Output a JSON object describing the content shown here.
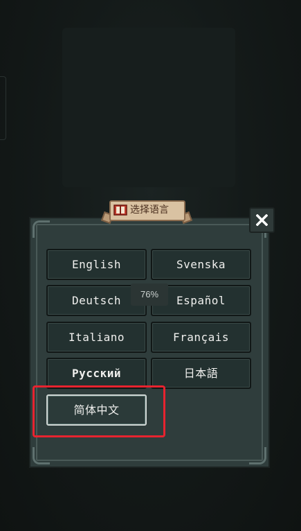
{
  "dialog": {
    "title": "选择语言",
    "close_icon": "close-icon",
    "title_icon": "book-icon"
  },
  "languages": [
    {
      "label": "English"
    },
    {
      "label": "Svenska"
    },
    {
      "label": "Deutsch"
    },
    {
      "label": "Español"
    },
    {
      "label": "Italiano"
    },
    {
      "label": "Français"
    },
    {
      "label": "Русский"
    },
    {
      "label": "日本語"
    },
    {
      "label": "简体中文",
      "selected": true
    }
  ],
  "overlay": {
    "zoom": "76%"
  },
  "colors": {
    "panel": "#2f3d3c",
    "button": "#233130",
    "banner": "#d9c2a2",
    "highlight": "#e8232f"
  }
}
